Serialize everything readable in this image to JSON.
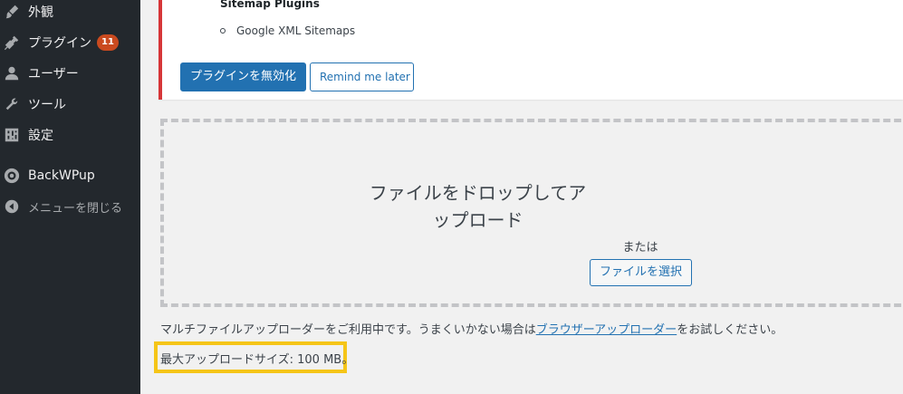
{
  "sidebar": {
    "items": [
      {
        "label": "外観",
        "icon": "paintbrush-icon"
      },
      {
        "label": "プラグイン",
        "icon": "plugin-icon",
        "badge": "11"
      },
      {
        "label": "ユーザー",
        "icon": "user-icon"
      },
      {
        "label": "ツール",
        "icon": "wrench-icon"
      },
      {
        "label": "設定",
        "icon": "settings-icon"
      },
      {
        "label": "BackWPup",
        "icon": "backwpup-icon"
      },
      {
        "label": "メニューを閉じる",
        "icon": "collapse-icon"
      }
    ]
  },
  "notice": {
    "heading": "Sitemap Plugins",
    "list_item": "Google XML Sitemaps",
    "deactivate_label": "プラグインを無効化",
    "remind_label": "Remind me later"
  },
  "upload": {
    "drop_title": "ファイルをドロップしてアップロード",
    "or_text": "または",
    "select_label": "ファイルを選択",
    "note_before": "マルチファイルアップローダーをご利用中です。うまくいかない場合は",
    "note_link": "ブラウザーアップローダー",
    "note_after": "をお試しください。",
    "max_size": "最大アップロードサイズ: 100 MB。"
  },
  "colors": {
    "sidebar_bg": "#23282d",
    "primary": "#2271b1",
    "notice_border": "#d63638",
    "badge": "#ca4a1f",
    "highlight": "#f5c518"
  }
}
